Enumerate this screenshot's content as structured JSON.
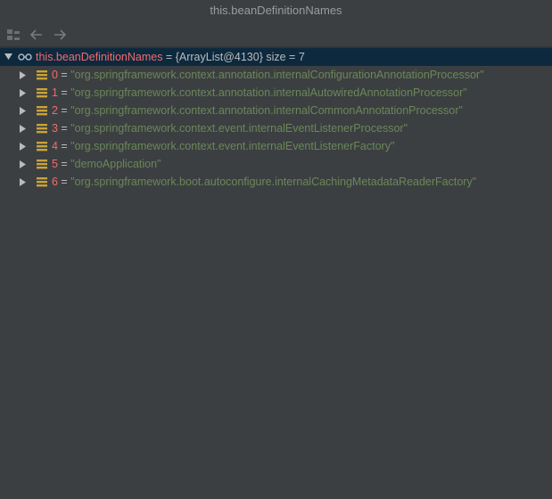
{
  "window": {
    "title": "this.beanDefinitionNames"
  },
  "toolbar": {
    "layout_icon": "tree-layout-icon",
    "back_icon": "arrow-left-icon",
    "forward_icon": "arrow-right-icon"
  },
  "root": {
    "name": "this.beanDefinitionNames",
    "eq": " = ",
    "type": "{ArrayList@4130}",
    "size": "  size = 7",
    "icon": "watch-glasses-icon"
  },
  "items": [
    {
      "index": "0",
      "eq": " = ",
      "value": "\"org.springframework.context.annotation.internalConfigurationAnnotationProcessor\""
    },
    {
      "index": "1",
      "eq": " = ",
      "value": "\"org.springframework.context.annotation.internalAutowiredAnnotationProcessor\""
    },
    {
      "index": "2",
      "eq": " = ",
      "value": "\"org.springframework.context.annotation.internalCommonAnnotationProcessor\""
    },
    {
      "index": "3",
      "eq": " = ",
      "value": "\"org.springframework.context.event.internalEventListenerProcessor\""
    },
    {
      "index": "4",
      "eq": " = ",
      "value": "\"org.springframework.context.event.internalEventListenerFactory\""
    },
    {
      "index": "5",
      "eq": " = ",
      "value": "\"demoApplication\""
    },
    {
      "index": "6",
      "eq": " = ",
      "value": "\"org.springframework.boot.autoconfigure.internalCachingMetadataReaderFactory\""
    }
  ],
  "colors": {
    "background": "#3c3f41",
    "selection": "#0d293e",
    "field_name": "#f36b6b",
    "string_value": "#6a8759",
    "array_icon": "#c9a338"
  }
}
